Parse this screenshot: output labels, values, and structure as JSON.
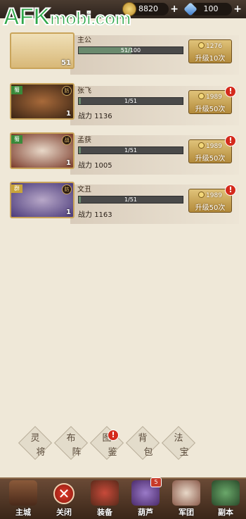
{
  "watermark": {
    "brand_a": "AFK",
    "brand_b": "mobi.com"
  },
  "resources": {
    "coins": "8820",
    "gems": "100"
  },
  "heroes": [
    {
      "name": "主公",
      "level": "51",
      "progress_text": "51/100",
      "progress": 0.51,
      "power_label": "",
      "power": "",
      "cost": "1276",
      "button": "升级10次",
      "faction": "",
      "tag": "",
      "alert": false,
      "portrait_color": "#e8d4a8"
    },
    {
      "name": "张飞",
      "level": "1",
      "progress_text": "1/51",
      "progress": 0.02,
      "power_label": "战力",
      "power": "1136",
      "cost": "1989",
      "button": "升级50次",
      "faction": "蜀",
      "tag": "防",
      "alert": true,
      "portrait_color": "#7a4a2a"
    },
    {
      "name": "孟获",
      "level": "1",
      "progress_text": "1/51",
      "progress": 0.02,
      "power_label": "战力",
      "power": "1005",
      "cost": "1989",
      "button": "升级50次",
      "faction": "蜀",
      "tag": "战",
      "alert": true,
      "portrait_color": "#8a6a4a"
    },
    {
      "name": "文丑",
      "level": "1",
      "progress_text": "1/51",
      "progress": 0.02,
      "power_label": "战力",
      "power": "1163",
      "cost": "1989",
      "button": "升级50次",
      "faction": "群",
      "tag": "防",
      "alert": true,
      "portrait_color": "#6a5a8a"
    }
  ],
  "tabs": [
    {
      "label_a": "灵",
      "label_b": "将"
    },
    {
      "label_a": "布",
      "label_b": "阵"
    },
    {
      "label_a": "图",
      "label_b": "鉴",
      "alert": "!"
    },
    {
      "label_a": "背",
      "label_b": "包"
    },
    {
      "label_a": "法",
      "label_b": "宝"
    }
  ],
  "nav": [
    {
      "label": "主城"
    },
    {
      "label": "关闭"
    },
    {
      "label": "装备"
    },
    {
      "label": "葫芦",
      "badge": "5"
    },
    {
      "label": "军团"
    },
    {
      "label": "副本"
    }
  ],
  "alert_symbol": "!",
  "close_symbol": "✕",
  "plus_symbol": "+"
}
